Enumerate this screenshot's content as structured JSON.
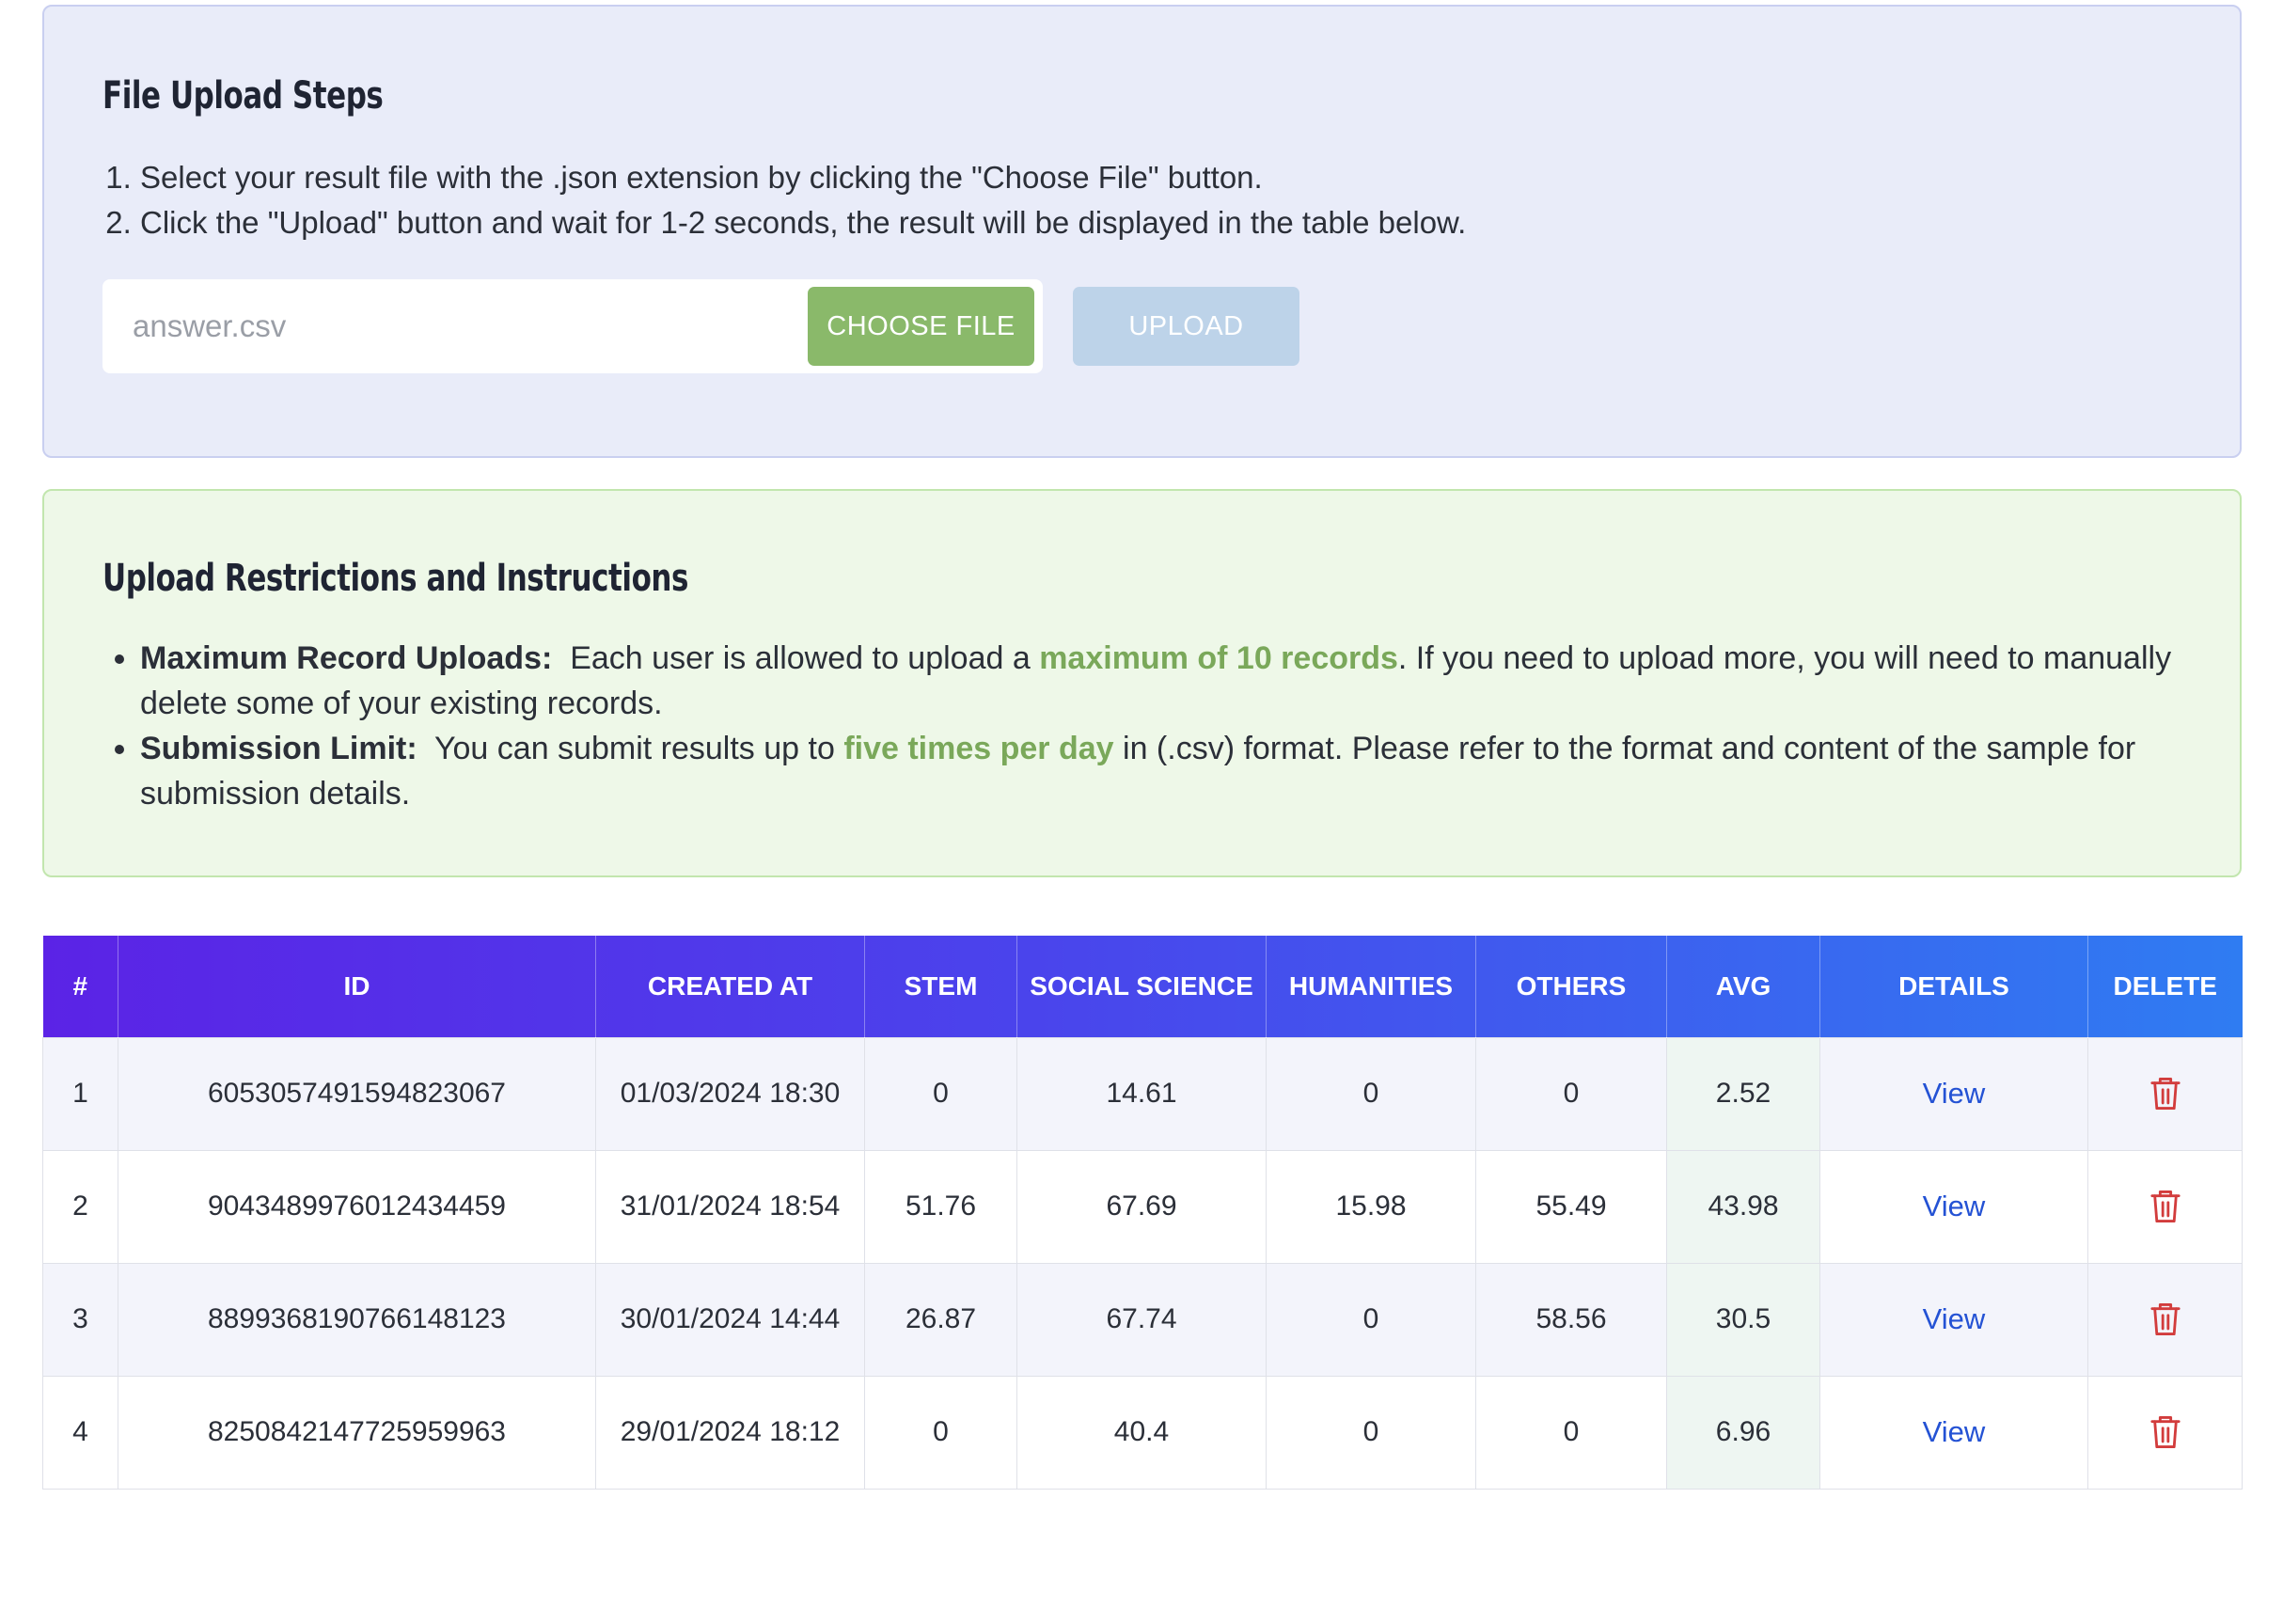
{
  "steps": {
    "title": "File Upload Steps",
    "items": [
      "Select your result file with the .json extension by clicking the \"Choose File\" button.",
      "Click the \"Upload\" button and wait for 1-2 seconds, the result will be displayed in the table below."
    ],
    "file_name": "answer.csv",
    "choose_label": "CHOOSE FILE",
    "upload_label": "UPLOAD"
  },
  "restrictions": {
    "title": "Upload Restrictions and Instructions",
    "rule1": {
      "label": "Maximum Record Uploads:",
      "pre": "Each user is allowed to upload a",
      "highlight": "maximum of 10 records",
      "post": ". If you need to upload more, you will need to manually delete some of your existing records."
    },
    "rule2": {
      "label": "Submission Limit:",
      "pre": "You can submit results up to",
      "highlight": "five times per day",
      "post": "in (.csv) format. Please refer to the format and content of the sample for submission details."
    }
  },
  "table": {
    "headers": [
      "#",
      "ID",
      "CREATED AT",
      "STEM",
      "SOCIAL SCIENCE",
      "HUMANITIES",
      "OTHERS",
      "AVG",
      "DETAILS",
      "DELETE"
    ],
    "view_label": "View",
    "rows": [
      {
        "num": "1",
        "id": "6053057491594823067",
        "created": "01/03/2024 18:30",
        "stem": "0",
        "social": "14.61",
        "humanities": "0",
        "others": "0",
        "avg": "2.52"
      },
      {
        "num": "2",
        "id": "9043489976012434459",
        "created": "31/01/2024 18:54",
        "stem": "51.76",
        "social": "67.69",
        "humanities": "15.98",
        "others": "55.49",
        "avg": "43.98"
      },
      {
        "num": "3",
        "id": "8899368190766148123",
        "created": "30/01/2024 14:44",
        "stem": "26.87",
        "social": "67.74",
        "humanities": "0",
        "others": "58.56",
        "avg": "30.5"
      },
      {
        "num": "4",
        "id": "8250842147725959963",
        "created": "29/01/2024 18:12",
        "stem": "0",
        "social": "40.4",
        "humanities": "0",
        "others": "0",
        "avg": "6.96"
      }
    ]
  },
  "colors": {
    "header_gradient_start": "#5b23e6",
    "header_gradient_end": "#2f7cf2",
    "highlight_green": "#7aa85a",
    "choose_button": "#8ab96a",
    "upload_button_disabled": "#bdd3e9",
    "link_blue": "#2452d4",
    "delete_red": "#d23c3c"
  }
}
